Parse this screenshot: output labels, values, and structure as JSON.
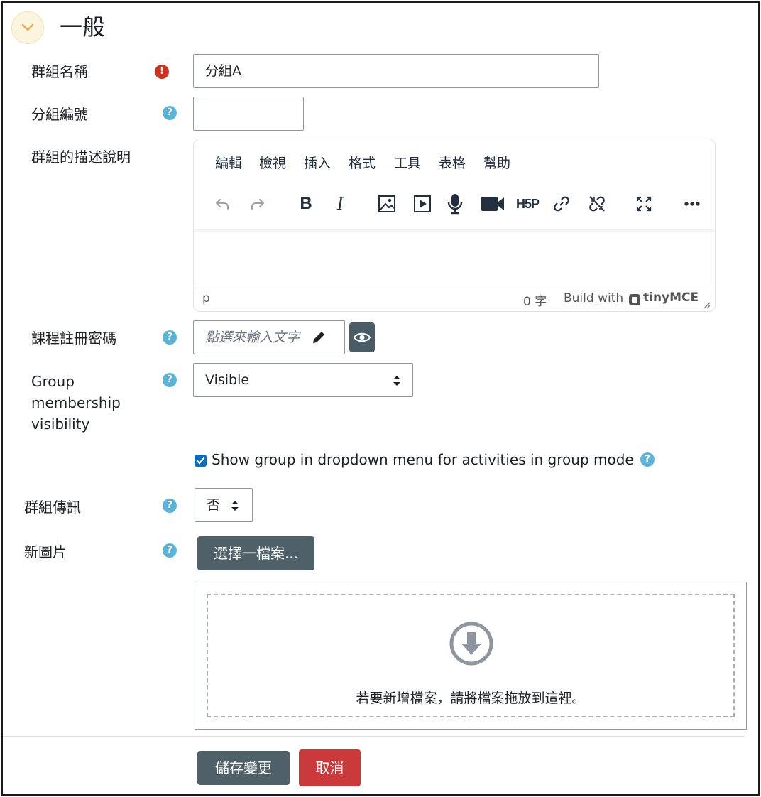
{
  "section": {
    "title": "一般",
    "collapse_icon": "chevron-down-icon"
  },
  "fields": {
    "group_name": {
      "label": "群組名稱",
      "value": "分組A",
      "required_icon": "exclamation-icon"
    },
    "group_id": {
      "label": "分組編號",
      "value": ""
    },
    "description": {
      "label": "群組的描述說明",
      "menu": [
        "編輯",
        "檢視",
        "插入",
        "格式",
        "工具",
        "表格",
        "幫助"
      ],
      "toolbar": [
        "undo-icon",
        "redo-icon",
        "bold-icon",
        "italic-icon",
        "image-icon",
        "media-icon",
        "microphone-icon",
        "video-camera-icon",
        "h5p-icon",
        "link-icon",
        "unlink-icon",
        "fullscreen-icon",
        "more-icon"
      ],
      "status_path": "p",
      "word_count": "0 字",
      "branding_prefix": "Build with",
      "branding_name": "tinyMCE"
    },
    "enrolment_key": {
      "label": "課程註冊密碼",
      "placeholder": "點選來輸入文字"
    },
    "membership_visibility": {
      "label_lines": [
        "Group",
        "membership",
        "visibility"
      ],
      "value": "Visible"
    },
    "show_in_dropdown": {
      "label": "Show group in dropdown menu for activities in group mode",
      "checked": true
    },
    "group_messaging": {
      "label": "群組傳訊",
      "value": "否"
    },
    "new_picture": {
      "label": "新圖片",
      "choose_button": "選擇一檔案...",
      "drop_text": "若要新增檔案，請將檔案拖放到這裡。"
    }
  },
  "actions": {
    "save": "儲存變更",
    "cancel": "取消"
  },
  "colors": {
    "primary": "#0f6cbf",
    "secondary": "#4f6069",
    "danger": "#ca3a3a",
    "help": "#5bb4d8",
    "required": "#ca3120"
  }
}
